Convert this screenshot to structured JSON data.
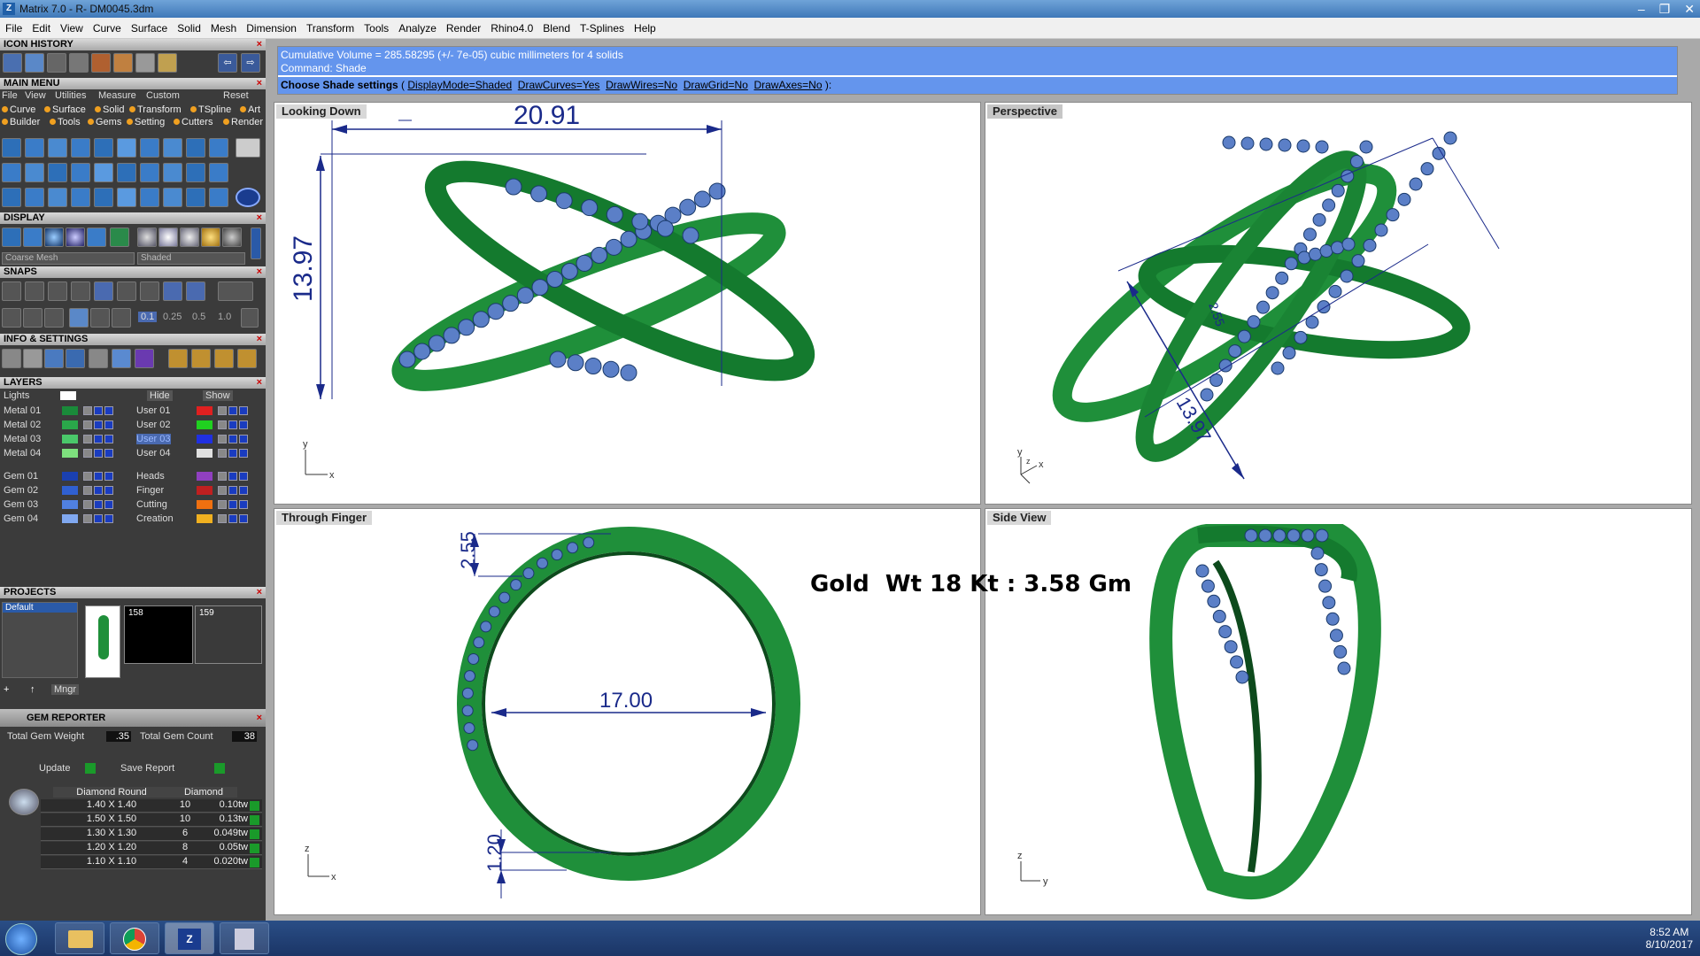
{
  "window": {
    "title": "Matrix 7.0 - R- DM0045.3dm",
    "app_icon": "Z",
    "controls": [
      "–",
      "❐",
      "✕"
    ]
  },
  "menubar": [
    "File",
    "Edit",
    "View",
    "Curve",
    "Surface",
    "Solid",
    "Mesh",
    "Dimension",
    "Transform",
    "Tools",
    "Analyze",
    "Render",
    "Rhino4.0",
    "Blend",
    "T-Splines",
    "Help"
  ],
  "panels": {
    "icon_history": "ICON HISTORY",
    "main_menu": "MAIN MENU",
    "main_menu_sub": [
      "File",
      "View",
      "Utilities",
      "Measure",
      "Custom"
    ],
    "main_menu_reset": "Reset",
    "main_menu_items_row1": [
      "Curve",
      "Surface",
      "Solid",
      "Transform",
      "TSpline",
      "Art"
    ],
    "main_menu_items_row2": [
      "Builder",
      "Tools",
      "Gems",
      "Setting",
      "Cutters",
      "Render"
    ],
    "display": "DISPLAY",
    "display_mesh": "Coarse Mesh",
    "display_shade": "Shaded",
    "snaps": "SNAPS",
    "snap_values": [
      "0.1",
      "0.25",
      "0.5",
      "1.0"
    ],
    "info_settings": "INFO & SETTINGS",
    "layers": "LAYERS",
    "layers_lights": "Lights",
    "layers_hide": "Hide",
    "layers_show": "Show",
    "layer_groups": [
      {
        "left": "Metal 01",
        "right": "User 01",
        "lc": "#1a8a3a",
        "rc": "#e02020"
      },
      {
        "left": "Metal 02",
        "right": "User 02",
        "lc": "#2aa84a",
        "rc": "#20d020"
      },
      {
        "left": "Metal 03",
        "right": "User 03",
        "lc": "#4ac86a",
        "rc": "#2030e0"
      },
      {
        "left": "Metal 04",
        "right": "User 04",
        "lc": "#7ee07e",
        "rc": "#e0e0e0"
      },
      {
        "left": "Gem 01",
        "right": "Heads",
        "lc": "#1a40b0",
        "rc": "#9040c0"
      },
      {
        "left": "Gem 02",
        "right": "Finger",
        "lc": "#3060d0",
        "rc": "#c02020"
      },
      {
        "left": "Gem 03",
        "right": "Cutting",
        "lc": "#5080e0",
        "rc": "#f07010"
      },
      {
        "left": "Gem 04",
        "right": "Creation",
        "lc": "#80a8f0",
        "rc": "#f0b020"
      }
    ],
    "projects": "PROJECTS",
    "project_default": "Default",
    "project_thumbs": [
      "158",
      "159"
    ],
    "projects_mngr": "Mngr",
    "gem_reporter": "GEM REPORTER",
    "total_gem_weight_label": "Total Gem Weight",
    "total_gem_weight": ".35",
    "total_gem_count_label": "Total Gem Count",
    "total_gem_count": "38",
    "update": "Update",
    "save_report": "Save Report",
    "gem_table_headers": [
      "Diamond Round",
      "Diamond"
    ],
    "gem_rows": [
      {
        "size": "1.40 X 1.40",
        "count": "10",
        "wt": "0.10tw"
      },
      {
        "size": "1.50 X 1.50",
        "count": "10",
        "wt": "0.13tw"
      },
      {
        "size": "1.30 X 1.30",
        "count": "6",
        "wt": "0.049tw"
      },
      {
        "size": "1.20 X 1.20",
        "count": "8",
        "wt": "0.05tw"
      },
      {
        "size": "1.10 X 1.10",
        "count": "4",
        "wt": "0.020tw"
      }
    ]
  },
  "command": {
    "line1": "Cumulative Volume = 285.58295 (+/- 7e-05) cubic millimeters for 4 solids",
    "line2": "Command: Shade",
    "prompt_head": "Choose Shade settings",
    "prompt_rest_1": " ( ",
    "opt1": "DisplayMode=Shaded",
    "opt2": "DrawCurves=Yes",
    "opt3": "DrawWires=No",
    "opt4": "DrawGrid=No",
    "opt5": "DrawAxes=No",
    "prompt_end": " ):"
  },
  "viewports": {
    "top_left": {
      "name": "Looking Down",
      "dim_w": "20.91",
      "dim_h": "13.97",
      "axis1": "y",
      "axis2": "x"
    },
    "top_right": {
      "name": "Perspective",
      "dim_a": "2.55",
      "dim_b": "13.97",
      "axis1": "y",
      "axis2": "x",
      "axis3": "z"
    },
    "bottom_left": {
      "name": "Through Finger",
      "dim_top": "2.55",
      "dim_diam": "17.00",
      "dim_bot": "1.20",
      "axis1": "z",
      "axis2": "x"
    },
    "bottom_right": {
      "name": "Side View",
      "axis1": "z",
      "axis2": "y"
    }
  },
  "overlay_text": "Gold  Wt 18 Kt : 3.58 Gm",
  "clock": {
    "time": "8:52 AM",
    "date": "8/10/2017"
  },
  "colors": {
    "ring": "#1f8f3a",
    "ring_dark": "#0d4a1c",
    "gem": "#5b7fc7",
    "dim": "#1a2a8a",
    "cmd_bg": "#6495ed"
  }
}
